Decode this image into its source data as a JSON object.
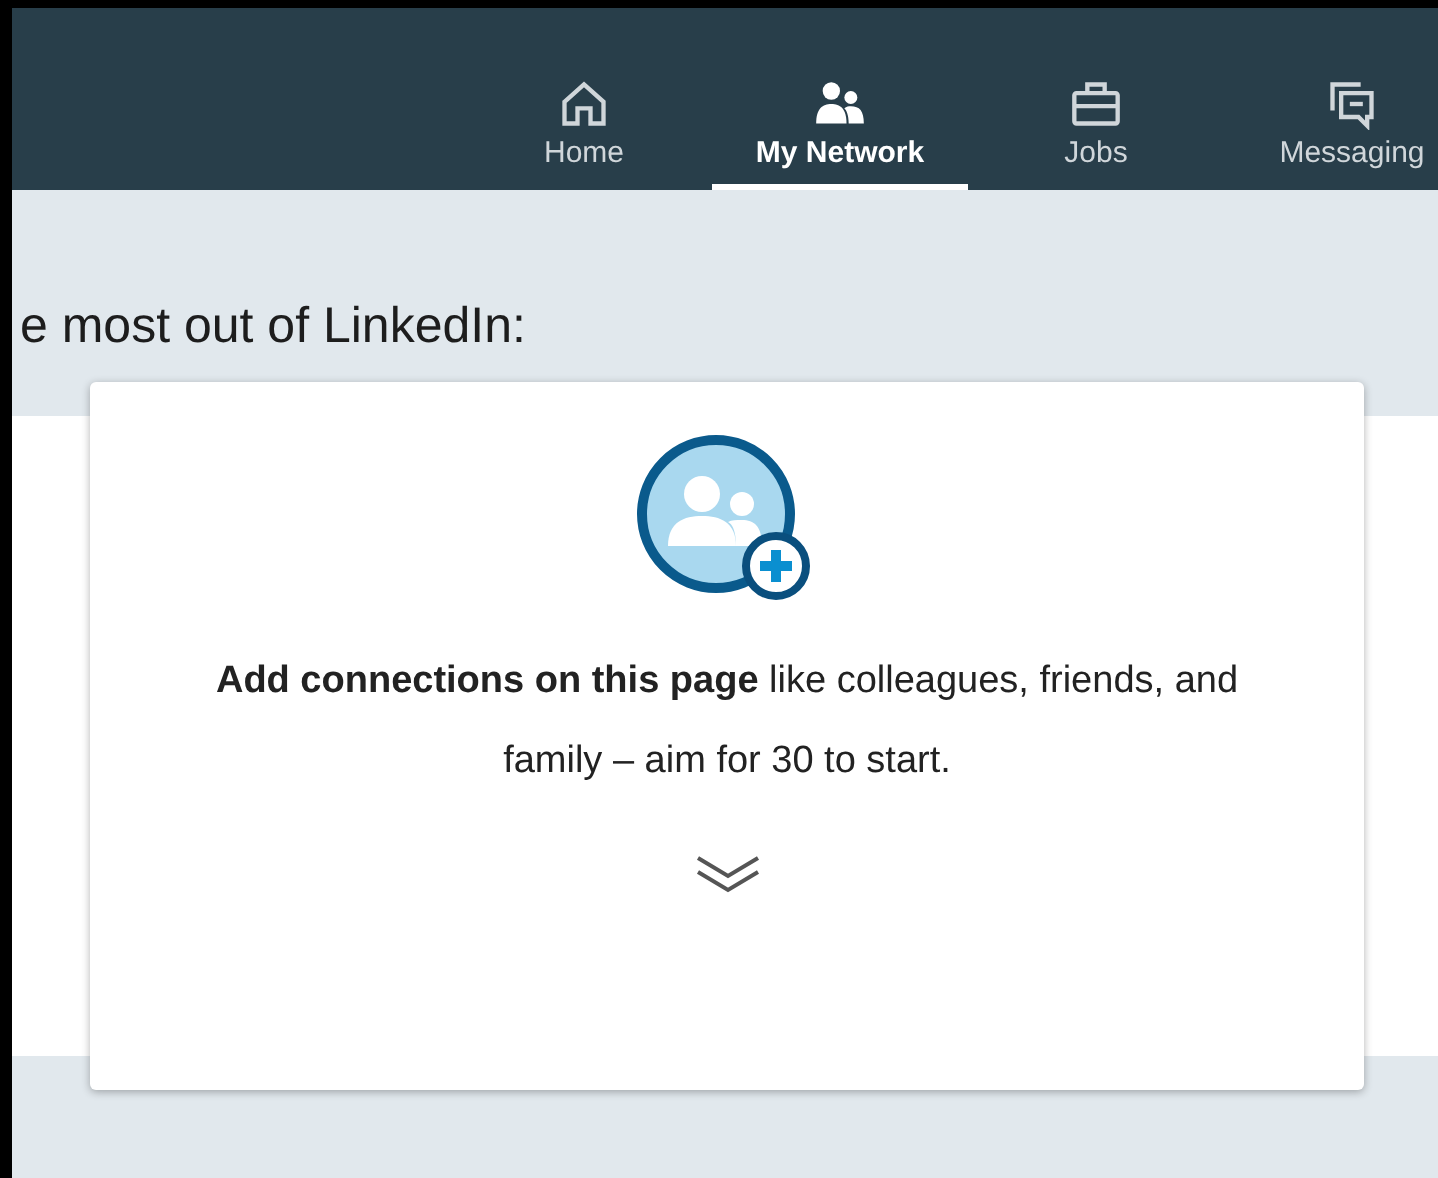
{
  "nav": {
    "items": [
      {
        "label": "Home",
        "kind": "home",
        "selected": false
      },
      {
        "label": "My Network",
        "kind": "network",
        "selected": true
      },
      {
        "label": "Jobs",
        "kind": "jobs",
        "selected": false
      },
      {
        "label": "Messaging",
        "kind": "messaging",
        "selected": false
      }
    ]
  },
  "heading": "e most out of LinkedIn:",
  "card": {
    "text": "**Add connections on this page** like colleagues, friends, and family – aim for 30 to start."
  }
}
